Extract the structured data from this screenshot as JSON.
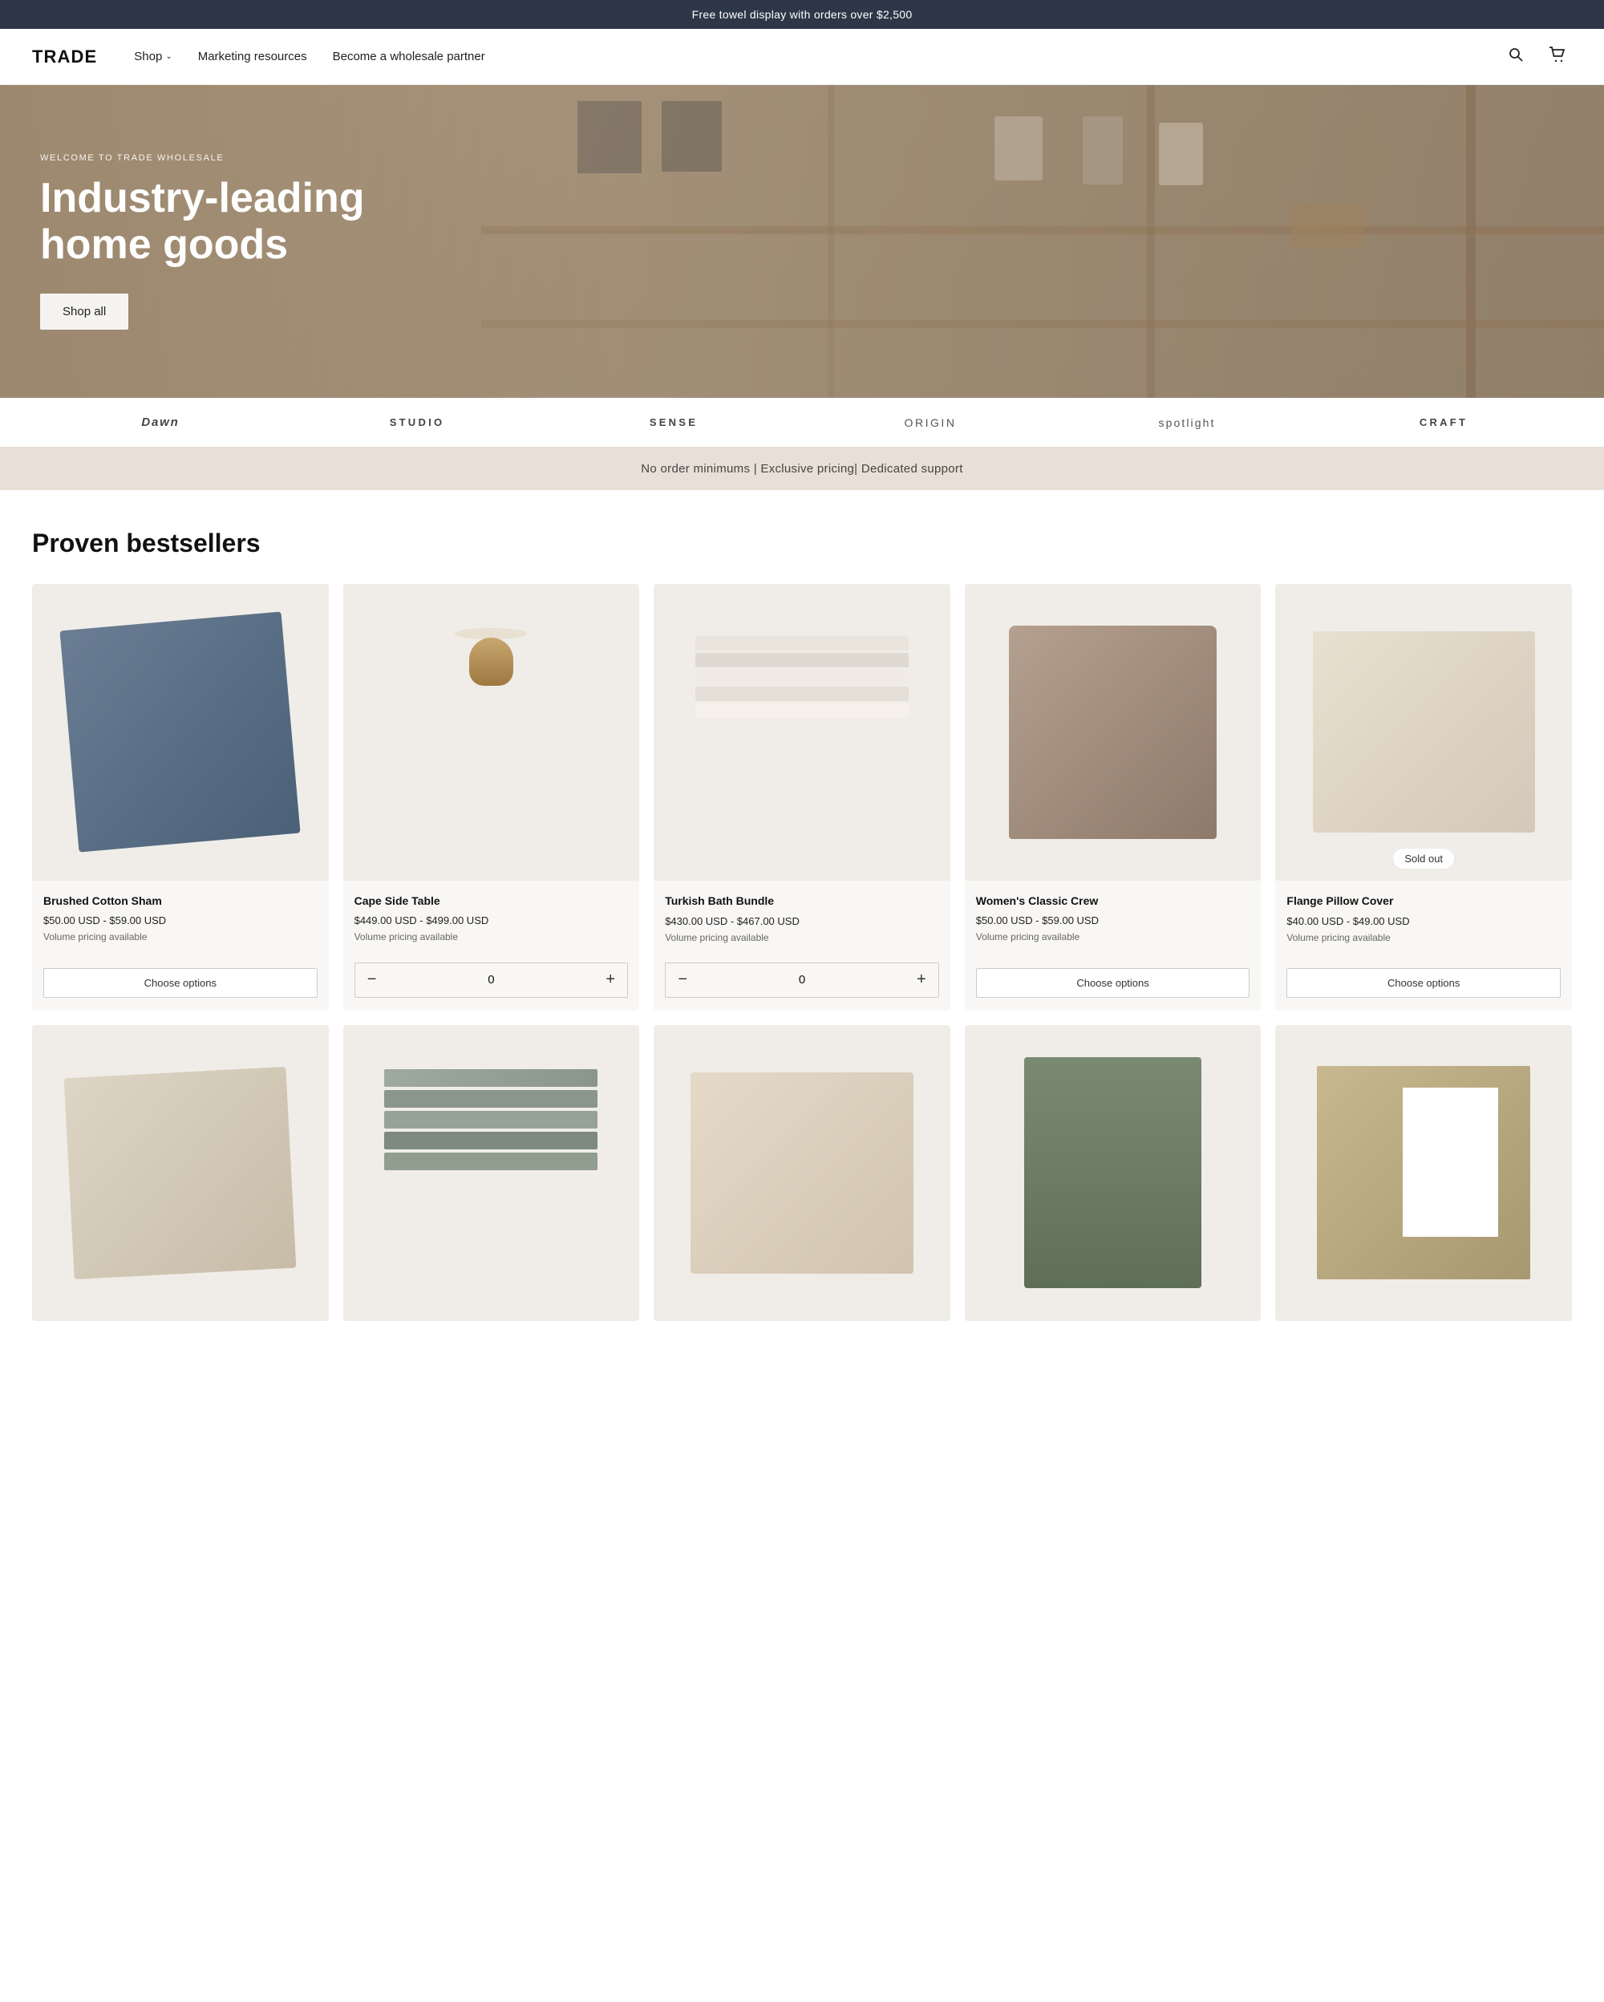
{
  "announcement": {
    "text": "Free towel display with orders over $2,500"
  },
  "header": {
    "logo": "TRADE",
    "nav": [
      {
        "label": "Shop",
        "hasDropdown": true
      },
      {
        "label": "Marketing resources"
      },
      {
        "label": "Become a wholesale partner"
      }
    ],
    "actions": {
      "search_label": "Search",
      "cart_label": "Cart"
    }
  },
  "hero": {
    "eyebrow": "WELCOME TO TRADE WHOLESALE",
    "title": "Industry-leading home goods",
    "cta_label": "Shop all"
  },
  "brands": [
    {
      "label": "Dawn",
      "style": "italic"
    },
    {
      "label": "STUDIO",
      "style": "bold-spacing"
    },
    {
      "label": "SENSE",
      "style": "bold-spacing"
    },
    {
      "label": "ORIGIN",
      "style": "outline"
    },
    {
      "label": "spotlight",
      "style": "light"
    },
    {
      "label": "CRAFT",
      "style": "bold-spacing"
    }
  ],
  "benefits": {
    "text": "No order minimums | Exclusive pricing| Dedicated support"
  },
  "bestsellers": {
    "title": "Proven bestsellers",
    "products": [
      {
        "name": "Brushed Cotton Sham",
        "price": "$50.00 USD - $59.00 USD",
        "volume_pricing": "Volume pricing available",
        "action_type": "choose",
        "action_label": "Choose options",
        "sold_out": false,
        "image_type": "pillow-blue"
      },
      {
        "name": "Cape Side Table",
        "price": "$449.00 USD - $499.00 USD",
        "volume_pricing": "Volume pricing available",
        "action_type": "quantity",
        "qty": "0",
        "sold_out": false,
        "image_type": "side-table"
      },
      {
        "name": "Turkish Bath Bundle",
        "price": "$430.00 USD - $467.00 USD",
        "volume_pricing": "Volume pricing available",
        "action_type": "quantity",
        "qty": "0",
        "sold_out": false,
        "image_type": "towels"
      },
      {
        "name": "Women's Classic Crew",
        "price": "$50.00 USD - $59.00 USD",
        "volume_pricing": "Volume pricing available",
        "action_type": "choose",
        "action_label": "Choose options",
        "sold_out": false,
        "image_type": "sweater"
      },
      {
        "name": "Flange Pillow Cover",
        "price": "$40.00 USD - $49.00 USD",
        "volume_pricing": "Volume pricing available",
        "action_type": "choose",
        "action_label": "Choose options",
        "sold_out": true,
        "sold_out_label": "Sold out",
        "image_type": "pillow-cream"
      }
    ],
    "row2_products": [
      {
        "name": "",
        "image_type": "pillow-cream2"
      },
      {
        "name": "",
        "image_type": "towels-gray"
      },
      {
        "name": "",
        "image_type": "pillow-linen"
      },
      {
        "name": "",
        "image_type": "pants-green"
      },
      {
        "name": "",
        "image_type": "art-board"
      }
    ]
  },
  "icons": {
    "search": "🔍",
    "cart": "🛍",
    "chevron_down": "⌄",
    "minus": "−",
    "plus": "+"
  }
}
